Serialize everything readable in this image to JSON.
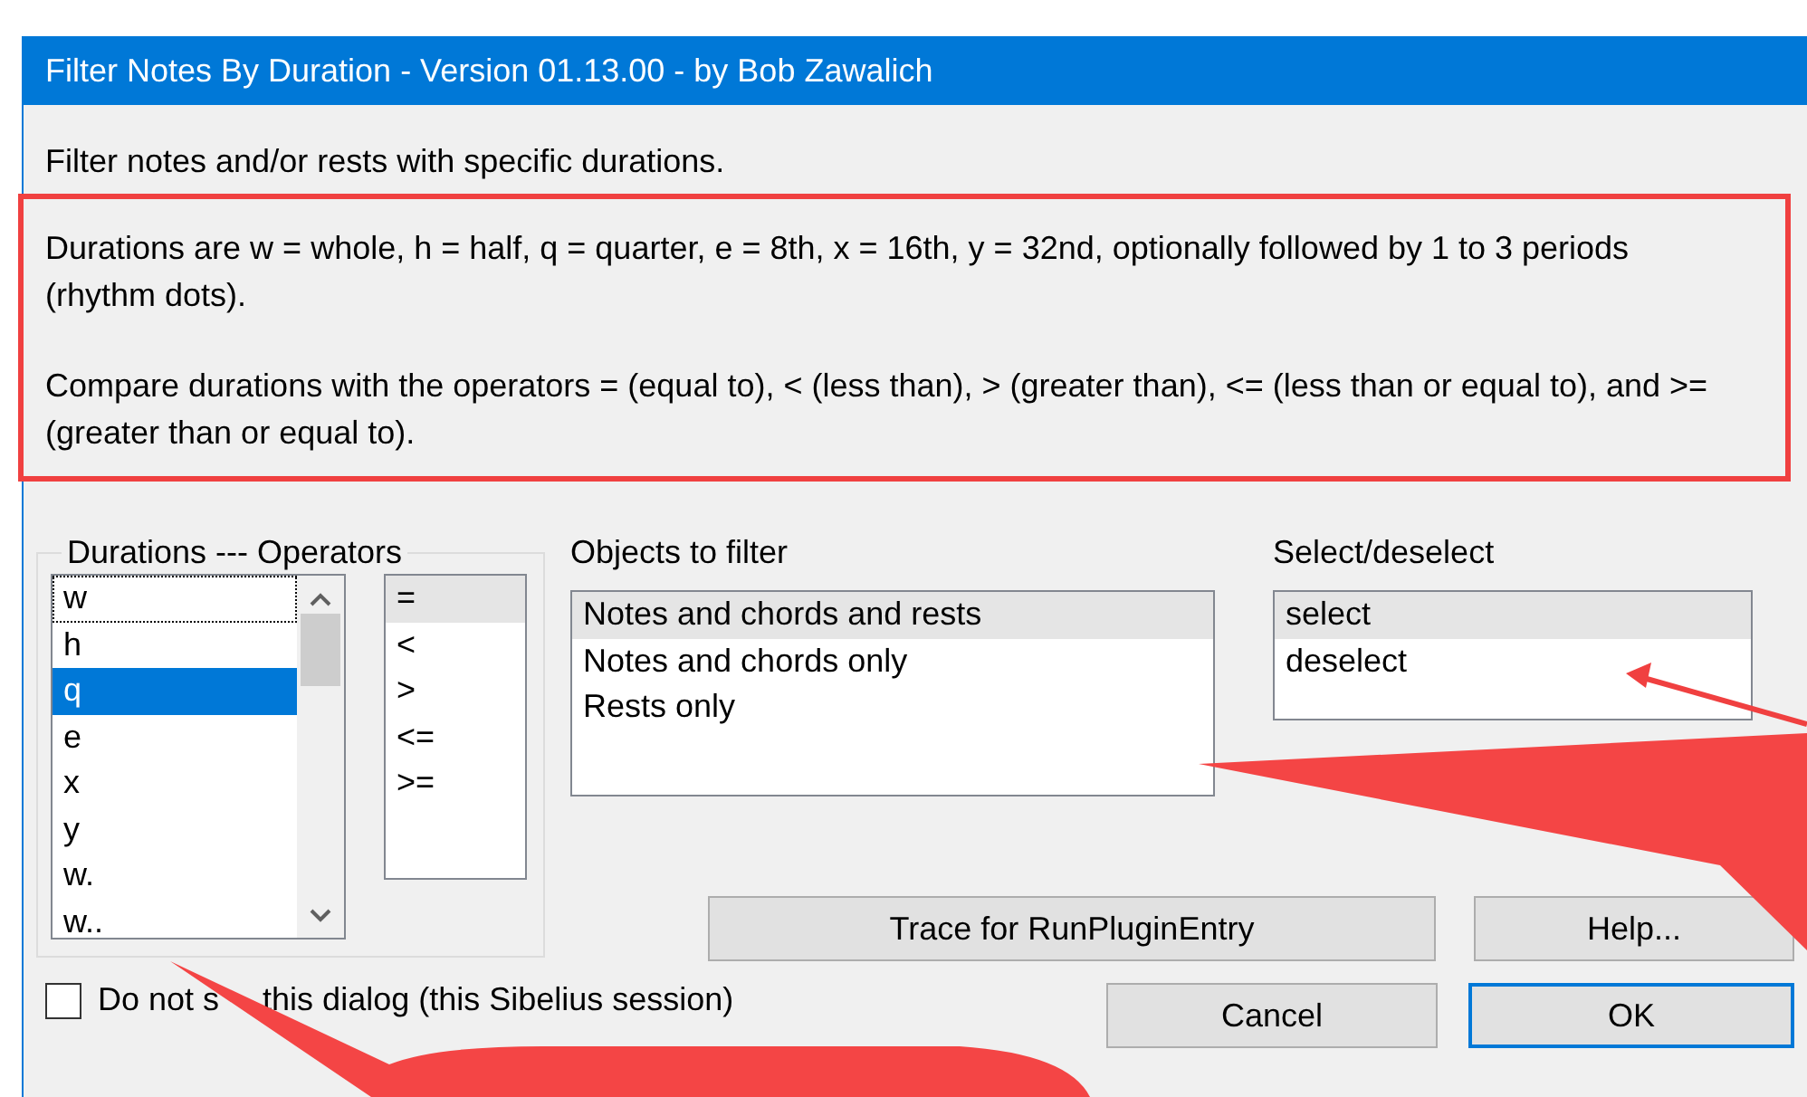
{
  "window": {
    "title": "Filter Notes By Duration - Version 01.13.00 - by Bob Zawalich"
  },
  "intro": "Filter notes and/or rests with specific durations.",
  "notes": [
    "Durations are w = whole, h = half, q = quarter, e = 8th, x = 16th, y = 32nd, optionally followed by 1 to 3 periods (rhythm dots).",
    "Compare durations with the operators = (equal to), < (less than), > (greater than), <= (less than or equal to), and >= (greater than or equal to)."
  ],
  "durations_group": {
    "title": "Durations --- Operators",
    "durations": {
      "active": true,
      "items": [
        {
          "label": "w",
          "selected": false,
          "focused": true
        },
        {
          "label": "h",
          "selected": false,
          "focused": false
        },
        {
          "label": "q",
          "selected": true,
          "focused": false
        },
        {
          "label": "e",
          "selected": false,
          "focused": false
        },
        {
          "label": "x",
          "selected": false,
          "focused": false
        },
        {
          "label": "y",
          "selected": false,
          "focused": false
        },
        {
          "label": "w.",
          "selected": false,
          "focused": false
        },
        {
          "label": "w..",
          "selected": false,
          "focused": false
        }
      ]
    },
    "operators": {
      "active": false,
      "items": [
        {
          "label": "=",
          "selected": true
        },
        {
          "label": "<",
          "selected": false
        },
        {
          "label": ">",
          "selected": false
        },
        {
          "label": "<=",
          "selected": false
        },
        {
          "label": ">=",
          "selected": false
        }
      ]
    }
  },
  "objects": {
    "label": "Objects to filter",
    "active": false,
    "items": [
      {
        "label": "Notes and chords and rests",
        "selected": true
      },
      {
        "label": "Notes and chords only",
        "selected": false
      },
      {
        "label": "Rests only",
        "selected": false
      }
    ]
  },
  "select_deselect": {
    "label": "Select/deselect",
    "active": false,
    "items": [
      {
        "label": "select",
        "selected": true
      },
      {
        "label": "deselect",
        "selected": false
      }
    ]
  },
  "checkbox": {
    "label_parts": [
      "Do not s",
      "this dialog (this Sibelius session)"
    ],
    "checked": false
  },
  "button_rows": [
    [
      {
        "label": "Trace for RunPluginEntry",
        "default": false
      },
      {
        "label": "Help...",
        "default": false
      }
    ],
    [
      {
        "label": "Cancel",
        "default": false
      },
      {
        "label": "OK",
        "default": true
      }
    ]
  ]
}
